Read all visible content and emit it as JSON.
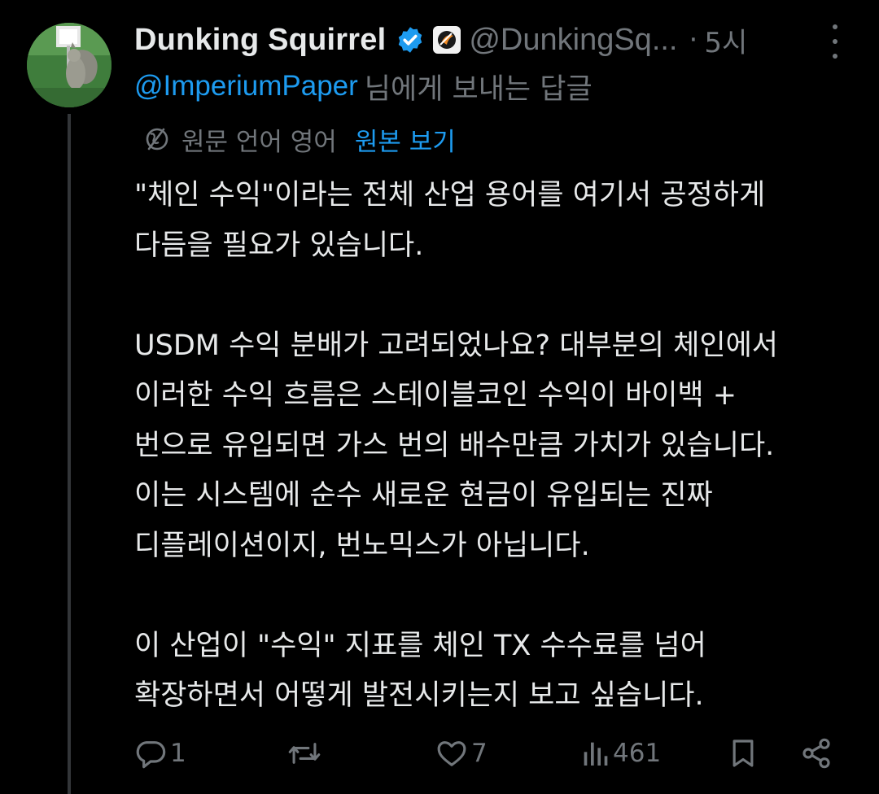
{
  "tweet": {
    "author": {
      "display_name": "Dunking Squirrel",
      "handle": "@DunkingSq...",
      "verified": true,
      "avatar_icon": "squirrel-avatar"
    },
    "time_separator": "·",
    "time": "5시",
    "reply_to": {
      "mention": "@ImperiumPaper",
      "suffix": "님에게 보내는 답글"
    },
    "translation": {
      "note": "원문 언어 영어",
      "show_original_label": "원본 보기"
    },
    "body": [
      {
        "lines": [
          "\"체인 수익\"이라는 전체 산업 용어를 여기서 공정하게",
          "다듬을 필요가 있습니다."
        ]
      },
      {
        "lines": [
          "USDM 수익 분배가 고려되었나요? 대부분의 체인에서",
          "이러한 수익 흐름은 스테이블코인 수익이 바이백 +",
          "번으로 유입되면 가스 번의 배수만큼 가치가 있습니다.",
          "이는 시스템에 순수 새로운 현금이 유입되는 진짜",
          "디플레이션이지, 번노믹스가 아닙니다."
        ]
      },
      {
        "lines": [
          "이 산업이 \"수익\" 지표를 체인 TX 수수료를 넘어",
          "확장하면서 어떻게 발전시키는지 보고 싶습니다."
        ]
      }
    ],
    "actions": {
      "reply_count": "1",
      "repost_count": "",
      "like_count": "7",
      "view_count": "461"
    }
  },
  "colors": {
    "background": "#000000",
    "text": "#e7e9ea",
    "muted": "#71767b",
    "accent": "#1d9bf0",
    "verified": "#1d9bf0"
  }
}
